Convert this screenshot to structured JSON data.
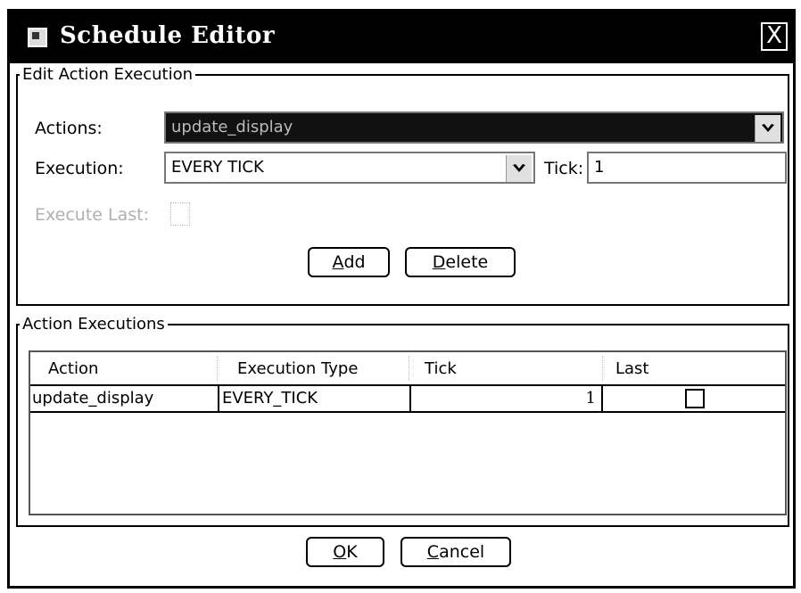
{
  "window": {
    "title": "Schedule Editor",
    "close_symbol": "X"
  },
  "edit_group": {
    "legend": "Edit Action Execution",
    "actions_label": "Actions:",
    "actions_value": "update_display",
    "execution_label": "Execution:",
    "execution_value": "EVERY TICK",
    "tick_label": "Tick:",
    "tick_value": "1",
    "execute_last_label": "Execute Last:",
    "add_button": {
      "mnemonic": "A",
      "rest": "dd"
    },
    "delete_button": {
      "mnemonic": "D",
      "rest": "elete"
    }
  },
  "executions_group": {
    "legend": "Action Executions",
    "columns": [
      "Action",
      "Execution Type",
      "Tick",
      "Last"
    ],
    "rows": [
      {
        "action": "update_display",
        "execution_type": "EVERY_TICK",
        "tick": "1",
        "last": false
      }
    ]
  },
  "footer": {
    "ok_button": {
      "mnemonic": "O",
      "rest": "K"
    },
    "cancel_button": {
      "mnemonic": "C",
      "rest": "ancel"
    }
  },
  "icons": [
    "app-icon",
    "close-icon",
    "dropdown-arrow-icon"
  ]
}
